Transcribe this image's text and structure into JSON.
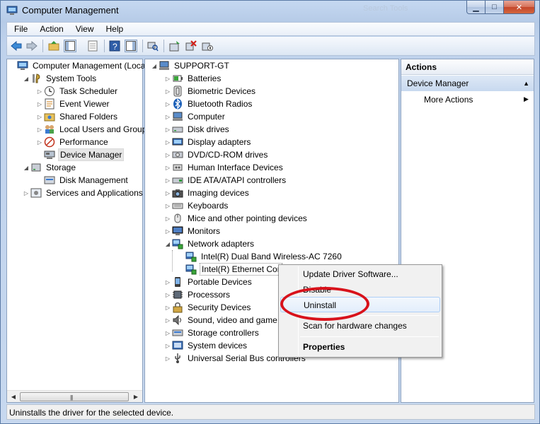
{
  "window": {
    "title": "Computer Management",
    "faded_title": "Search Tools"
  },
  "menubar": [
    "File",
    "Action",
    "View",
    "Help"
  ],
  "left_tree": [
    {
      "label": "Computer Management (Local",
      "icon": "computer-management-icon",
      "level": 0,
      "arrow": "",
      "selected": false
    },
    {
      "label": "System Tools",
      "icon": "system-tools-icon",
      "level": 1,
      "arrow": "down",
      "selected": false
    },
    {
      "label": "Task Scheduler",
      "icon": "clock-icon",
      "level": 2,
      "arrow": "right",
      "selected": false
    },
    {
      "label": "Event Viewer",
      "icon": "event-viewer-icon",
      "level": 2,
      "arrow": "right",
      "selected": false
    },
    {
      "label": "Shared Folders",
      "icon": "shared-folder-icon",
      "level": 2,
      "arrow": "right",
      "selected": false
    },
    {
      "label": "Local Users and Groups",
      "icon": "users-icon",
      "level": 2,
      "arrow": "right",
      "selected": false
    },
    {
      "label": "Performance",
      "icon": "performance-icon",
      "level": 2,
      "arrow": "right",
      "selected": false
    },
    {
      "label": "Device Manager",
      "icon": "device-manager-icon",
      "level": 2,
      "arrow": "",
      "selected": true
    },
    {
      "label": "Storage",
      "icon": "storage-icon",
      "level": 1,
      "arrow": "down",
      "selected": false
    },
    {
      "label": "Disk Management",
      "icon": "disk-management-icon",
      "level": 2,
      "arrow": "",
      "selected": false
    },
    {
      "label": "Services and Applications",
      "icon": "services-icon",
      "level": 1,
      "arrow": "right",
      "selected": false
    }
  ],
  "device_tree": {
    "root": "SUPPORT-GT",
    "items": [
      {
        "label": "Batteries",
        "icon": "battery-icon",
        "level": 1,
        "arrow": "right"
      },
      {
        "label": "Biometric Devices",
        "icon": "biometric-icon",
        "level": 1,
        "arrow": "right"
      },
      {
        "label": "Bluetooth Radios",
        "icon": "bluetooth-icon",
        "level": 1,
        "arrow": "right"
      },
      {
        "label": "Computer",
        "icon": "computer-icon",
        "level": 1,
        "arrow": "right"
      },
      {
        "label": "Disk drives",
        "icon": "disk-drive-icon",
        "level": 1,
        "arrow": "right"
      },
      {
        "label": "Display adapters",
        "icon": "display-adapter-icon",
        "level": 1,
        "arrow": "right"
      },
      {
        "label": "DVD/CD-ROM drives",
        "icon": "dvd-icon",
        "level": 1,
        "arrow": "right"
      },
      {
        "label": "Human Interface Devices",
        "icon": "hid-icon",
        "level": 1,
        "arrow": "right"
      },
      {
        "label": "IDE ATA/ATAPI controllers",
        "icon": "ide-icon",
        "level": 1,
        "arrow": "right"
      },
      {
        "label": "Imaging devices",
        "icon": "imaging-icon",
        "level": 1,
        "arrow": "right"
      },
      {
        "label": "Keyboards",
        "icon": "keyboard-icon",
        "level": 1,
        "arrow": "right"
      },
      {
        "label": "Mice and other pointing devices",
        "icon": "mouse-icon",
        "level": 1,
        "arrow": "right"
      },
      {
        "label": "Monitors",
        "icon": "monitor-icon",
        "level": 1,
        "arrow": "right"
      },
      {
        "label": "Network adapters",
        "icon": "network-adapter-icon",
        "level": 1,
        "arrow": "down"
      },
      {
        "label": "Intel(R) Dual Band Wireless-AC 7260",
        "icon": "network-adapter-icon",
        "level": 2,
        "arrow": ""
      },
      {
        "label": "Intel(R) Ethernet Cor",
        "icon": "network-adapter-icon",
        "level": 2,
        "arrow": "",
        "selected": true
      },
      {
        "label": "Portable Devices",
        "icon": "portable-device-icon",
        "level": 1,
        "arrow": "right"
      },
      {
        "label": "Processors",
        "icon": "processor-icon",
        "level": 1,
        "arrow": "right"
      },
      {
        "label": "Security Devices",
        "icon": "security-device-icon",
        "level": 1,
        "arrow": "right"
      },
      {
        "label": "Sound, video and game",
        "icon": "sound-icon",
        "level": 1,
        "arrow": "right"
      },
      {
        "label": "Storage controllers",
        "icon": "storage-controller-icon",
        "level": 1,
        "arrow": "right"
      },
      {
        "label": "System devices",
        "icon": "system-device-icon",
        "level": 1,
        "arrow": "right"
      },
      {
        "label": "Universal Serial Bus controllers",
        "icon": "usb-icon",
        "level": 1,
        "arrow": "right"
      }
    ]
  },
  "actions": {
    "header": "Actions",
    "section": "Device Manager",
    "more": "More Actions"
  },
  "context_menu": {
    "update": "Update Driver Software...",
    "disable": "Disable",
    "uninstall": "Uninstall",
    "scan": "Scan for hardware changes",
    "properties": "Properties"
  },
  "statusbar": {
    "text": "Uninstalls the driver for the selected device."
  },
  "colors": {
    "highlight_ellipse": "#d8121b",
    "titlebar": "#c5d8f1"
  }
}
